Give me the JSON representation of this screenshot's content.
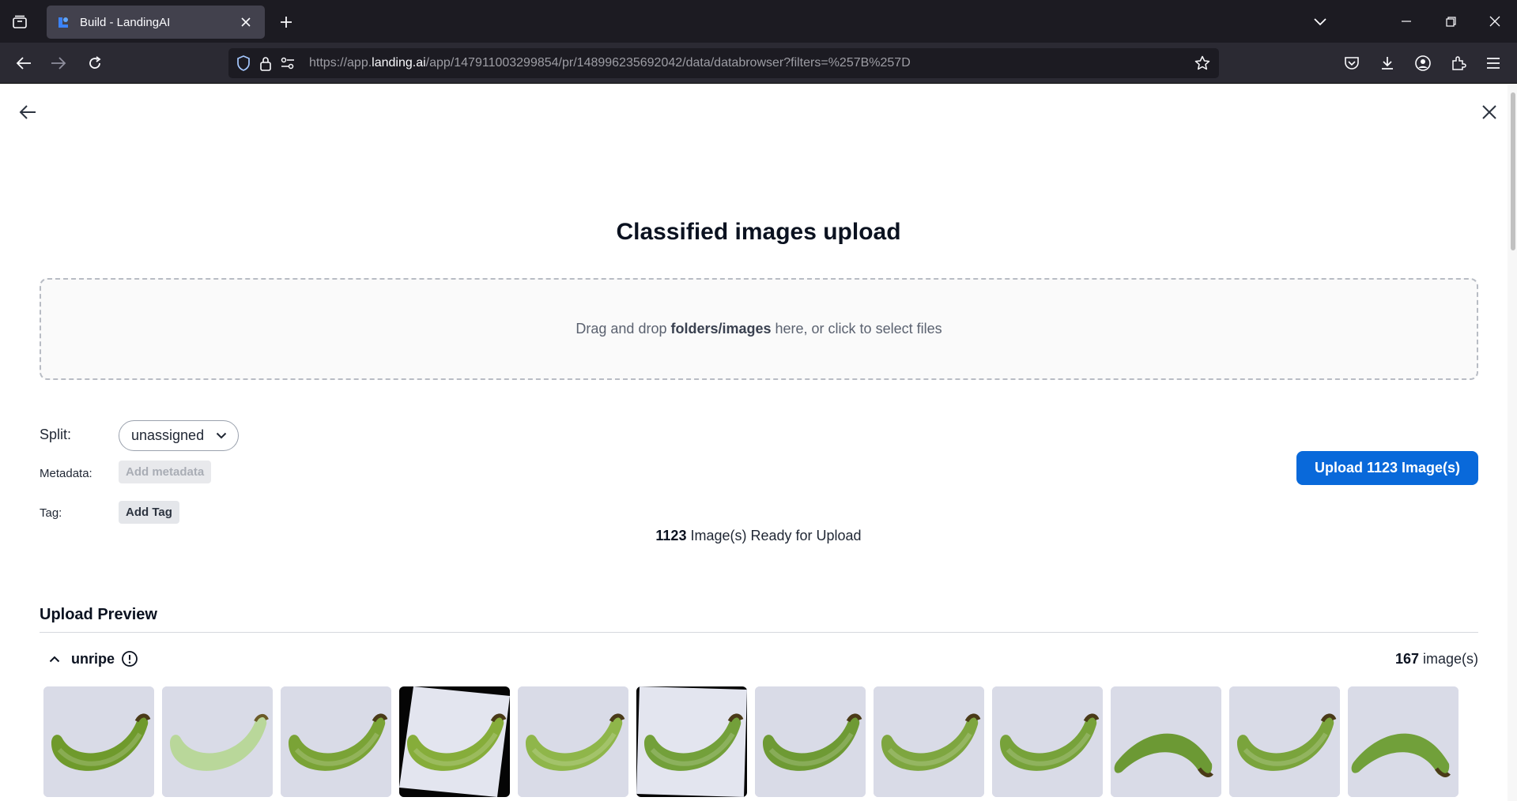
{
  "browser": {
    "tab_title": "Build - LandingAI",
    "url_prefix": "https://app.",
    "url_host": "landing.ai",
    "url_path": "/app/147911003299854/pr/148996235692042/data/databrowser?filters=%257B%257D"
  },
  "page": {
    "title": "Classified images upload",
    "dropzone": {
      "before": "Drag and drop ",
      "bold": "folders/images",
      "after": " here, or click to select files"
    },
    "split_label": "Split:",
    "split_value": "unassigned",
    "metadata_label": "Metadata:",
    "metadata_button": "Add metadata",
    "tag_label": "Tag:",
    "tag_button": "Add Tag",
    "upload_button": "Upload 1123 Image(s)",
    "ready_count": "1123",
    "ready_text": " Image(s) Ready for Upload",
    "preview_title": "Upload Preview",
    "group": {
      "name": "unripe",
      "count": "167",
      "count_suffix": " image(s)"
    }
  },
  "thumbnails": [
    {
      "variant": "normal",
      "tone": "#6f9a2c"
    },
    {
      "variant": "pale",
      "tone": "#b9d79a"
    },
    {
      "variant": "normal",
      "tone": "#7aa336"
    },
    {
      "variant": "rotated",
      "tone": "#86ad3a"
    },
    {
      "variant": "normal",
      "tone": "#8fb64a"
    },
    {
      "variant": "rotated-light",
      "tone": "#73a03a"
    },
    {
      "variant": "normal",
      "tone": "#6e9a34"
    },
    {
      "variant": "normal",
      "tone": "#7ea640"
    },
    {
      "variant": "normal",
      "tone": "#77a23a"
    },
    {
      "variant": "curve",
      "tone": "#6c9934"
    },
    {
      "variant": "normal",
      "tone": "#7aa43c"
    },
    {
      "variant": "curve",
      "tone": "#71a03a"
    }
  ]
}
